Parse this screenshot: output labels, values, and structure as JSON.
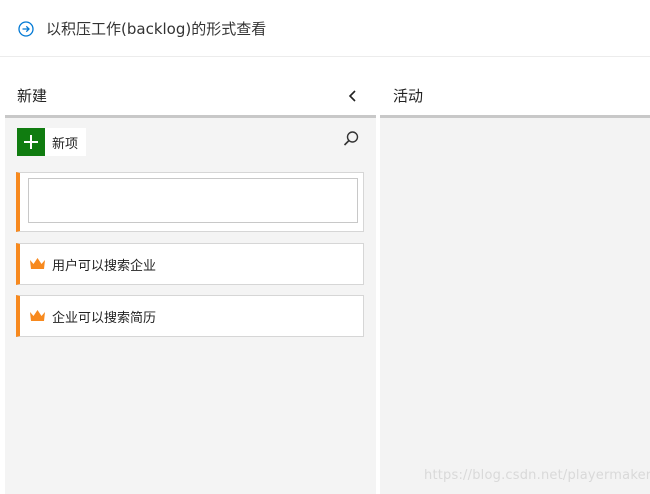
{
  "header": {
    "icon": "circle-arrow-right-icon",
    "title": "以积压工作(backlog)的形式查看"
  },
  "columns": [
    {
      "name": "新建",
      "collapse_icon": "chevron-left-icon",
      "add_button_label": "新项",
      "search_icon": "search-icon",
      "new_item_input": {
        "value": "",
        "placeholder": ""
      },
      "cards": [
        {
          "title": "用户可以搜索企业",
          "icon": "crown-icon"
        },
        {
          "title": "企业可以搜索简历",
          "icon": "crown-icon"
        }
      ]
    },
    {
      "name": "活动"
    }
  ],
  "watermark": "https://blog.csdn.net/playermaker",
  "colors": {
    "accent_orange": "#f7891e",
    "add_green": "#107c10",
    "link_blue": "#0078d4",
    "column_bg": "#f4f4f4"
  }
}
